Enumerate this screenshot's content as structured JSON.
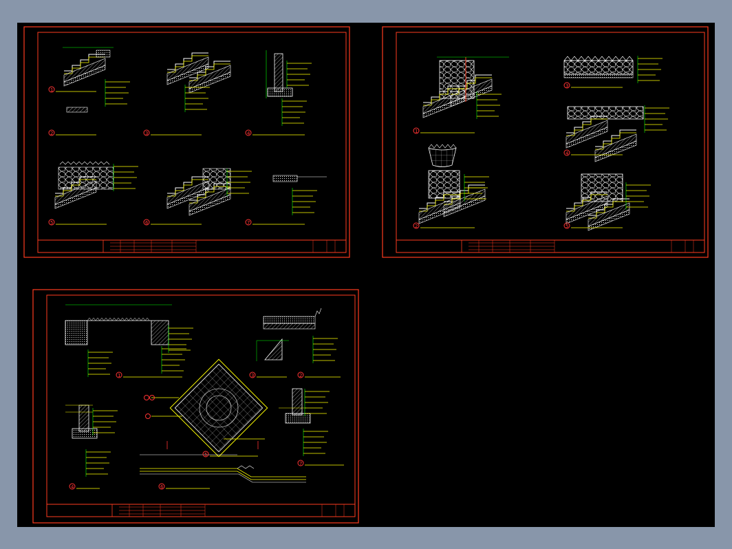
{
  "window": {
    "background": "#8896aa",
    "canvas_background": "#000000"
  },
  "colors": {
    "frame": "#ff3b1f",
    "line": "#ffffff",
    "dimension": "#00ff00",
    "annotation": "#ffff00",
    "detail_number": "#ff3333",
    "hatch": "#cccccc"
  },
  "sheets": [
    {
      "id": "sheet-1",
      "details": [
        {
          "number": "1",
          "caption": ""
        },
        {
          "number": "2",
          "caption": ""
        },
        {
          "number": "3",
          "caption": ""
        },
        {
          "number": "4",
          "caption": ""
        },
        {
          "number": "5",
          "caption": ""
        },
        {
          "number": "6",
          "caption": ""
        },
        {
          "number": "7",
          "caption": ""
        }
      ]
    },
    {
      "id": "sheet-2",
      "details": [
        {
          "number": "1",
          "caption": ""
        },
        {
          "number": "2",
          "caption": ""
        },
        {
          "number": "3",
          "caption": ""
        },
        {
          "number": "4",
          "caption": ""
        },
        {
          "number": "5",
          "caption": ""
        }
      ]
    },
    {
      "id": "sheet-3",
      "details": [
        {
          "number": "1",
          "caption": ""
        },
        {
          "number": "2",
          "caption": ""
        },
        {
          "number": "3",
          "caption": ""
        },
        {
          "number": "4",
          "caption": ""
        },
        {
          "number": "5",
          "caption": ""
        },
        {
          "number": "6",
          "caption": ""
        },
        {
          "number": "7",
          "caption": ""
        }
      ]
    }
  ]
}
